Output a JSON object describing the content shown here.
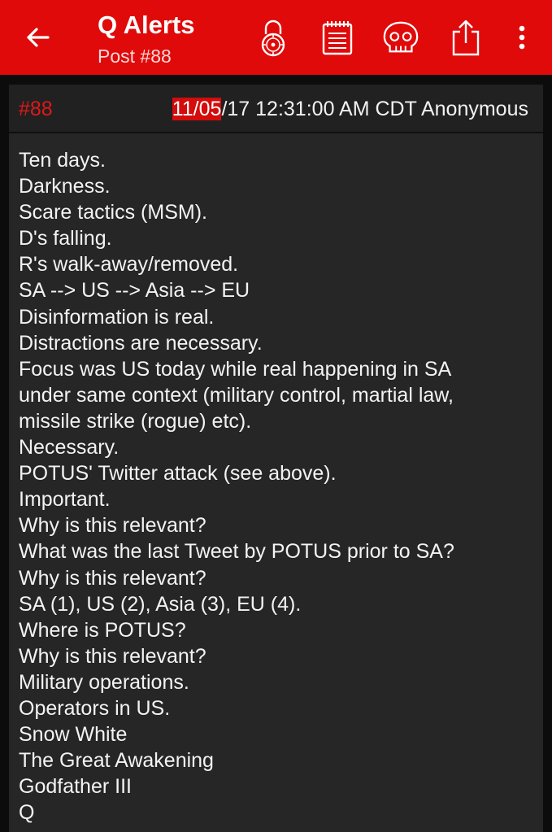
{
  "app": {
    "title": "Q Alerts",
    "subtitle": "Post #88",
    "accent": "#e00a0a"
  },
  "toolbar": {
    "back_icon": "arrow-left-icon",
    "actions": [
      "lock-icon",
      "notepad-icon",
      "skull-icon",
      "share-icon",
      "more-vert-icon"
    ]
  },
  "post": {
    "number": "#88",
    "date_highlight": "11/05",
    "date_rest": "/17 12:31:00 AM CDT Anonymous",
    "lines": [
      "Ten days.",
      "Darkness.",
      "Scare tactics (MSM).",
      "D's falling.",
      "R's walk-away/removed.",
      "SA --> US --> Asia --> EU",
      "Disinformation is real.",
      "Distractions are necessary.",
      "Focus was US today while real happening in SA",
      "under same context (military control, martial law,",
      "missile strike (rogue) etc).",
      "Necessary.",
      "POTUS' Twitter attack (see above).",
      "Important.",
      "Why is this relevant?",
      "What was the last Tweet by POTUS prior to SA?",
      "Why is this relevant?",
      "SA (1), US (2), Asia (3), EU (4).",
      "Where is POTUS?",
      "Why is this relevant?",
      "Military operations.",
      "Operators in US.",
      "Snow White",
      "The Great Awakening",
      "Godfather III",
      "Q"
    ]
  }
}
